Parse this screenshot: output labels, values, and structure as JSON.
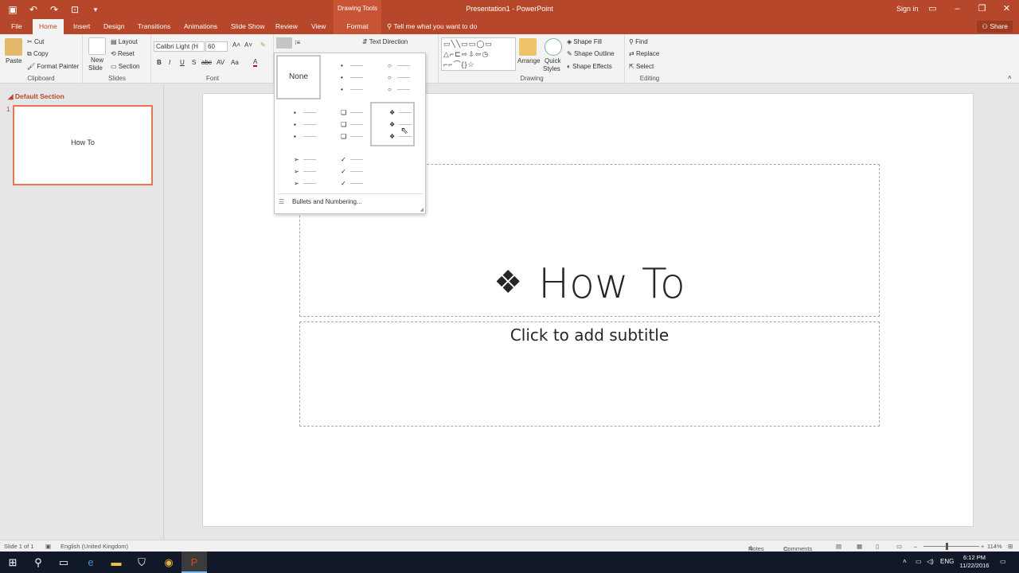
{
  "titlebar": {
    "title": "Presentation1 - PowerPoint",
    "context_tab": "Drawing Tools",
    "sign_in": "Sign in",
    "qat_icons": [
      "save-icon",
      "undo-icon",
      "redo-icon",
      "start-from-beginning-icon",
      "customize-qat-icon"
    ],
    "window_buttons": [
      "ribbon-display-options-icon",
      "minimize-icon",
      "maximize-icon",
      "close-icon"
    ]
  },
  "tabs": {
    "items": [
      "File",
      "Home",
      "Insert",
      "Design",
      "Transitions",
      "Animations",
      "Slide Show",
      "Review",
      "View",
      "Format"
    ],
    "active": "Home",
    "tell_me": "Tell me what you want to do",
    "share": "Share"
  },
  "ribbon": {
    "clipboard": {
      "label": "Clipboard",
      "paste": "Paste",
      "cut": "Cut",
      "copy": "Copy",
      "format_painter": "Format Painter"
    },
    "slides": {
      "label": "Slides",
      "new_slide": "New",
      "new_slide2": "Slide",
      "layout": "Layout",
      "reset": "Reset",
      "section": "Section"
    },
    "font": {
      "label": "Font",
      "font_name": "Calibri Light (H",
      "font_size": "60",
      "bold": "B",
      "italic": "I",
      "underline": "U",
      "shadow": "S",
      "strike": "abc",
      "spacing": "AV",
      "case": "Aa",
      "font_color": "A"
    },
    "paragraph": {
      "text_direction": "Text Direction"
    },
    "drawing": {
      "label": "Drawing",
      "arrange": "Arrange",
      "quick_styles": "Quick",
      "quick_styles2": "Styles",
      "shape_fill": "Shape Fill",
      "shape_outline": "Shape Outline",
      "shape_effects": "Shape Effects",
      "shapes_gallery": "▭╲╲▭▭◯▭ △⌐⊏⇨⇩⇦◷ ⌐⌐⌒{}☆"
    },
    "editing": {
      "label": "Editing",
      "find": "Find",
      "replace": "Replace",
      "select": "Select"
    }
  },
  "left_panel": {
    "section_name": "Default Section",
    "slide_number": "1",
    "thumbnail_text": "How To"
  },
  "slide": {
    "title_bullet": "❖",
    "title": "How To",
    "subtitle_placeholder": "Click to add subtitle"
  },
  "bullet_gallery": {
    "none_label": "None",
    "options": [
      {
        "name": "filled-round-bullets",
        "glyph": "•"
      },
      {
        "name": "hollow-round-bullets",
        "glyph": "○"
      },
      {
        "name": "filled-square-bullets",
        "glyph": "▪"
      },
      {
        "name": "hollow-square-bullets",
        "glyph": "❑"
      },
      {
        "name": "star-bullets",
        "glyph": "❖"
      },
      {
        "name": "arrow-bullets",
        "glyph": "➢"
      },
      {
        "name": "checkmark-bullets",
        "glyph": "✓"
      }
    ],
    "selected": "star-bullets",
    "footer": "Bullets and Numbering..."
  },
  "statusbar": {
    "slide_info": "Slide 1 of 1",
    "language": "English (United Kingdom)",
    "notes": "Notes",
    "comments": "Comments",
    "zoom": "114%"
  },
  "taskbar": {
    "apps": [
      "windows-start-icon",
      "search-icon",
      "task-view-icon",
      "edge-icon",
      "file-explorer-icon",
      "store-icon",
      "chrome-icon",
      "powerpoint-icon"
    ],
    "active_app": "powerpoint-icon",
    "language": "ENG",
    "time": "6:12 PM",
    "date": "11/22/2016"
  },
  "colors": {
    "accent": "#b7472a",
    "selection": "#e87457"
  }
}
